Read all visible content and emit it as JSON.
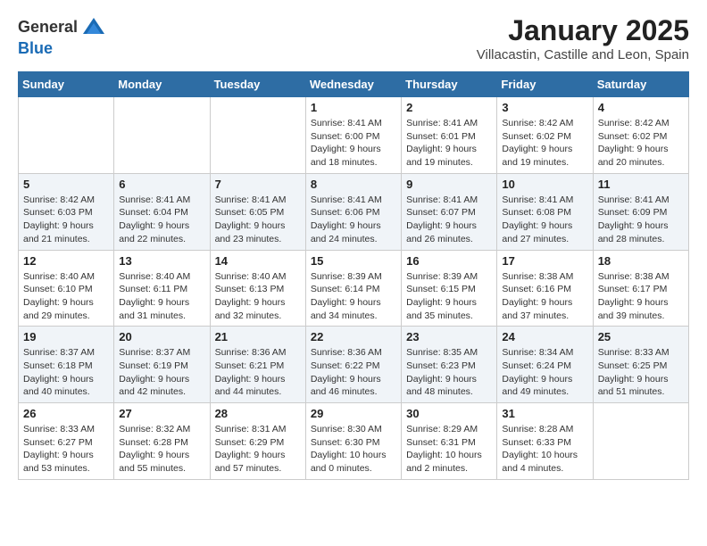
{
  "logo": {
    "general": "General",
    "blue": "Blue"
  },
  "header": {
    "month": "January 2025",
    "location": "Villacastin, Castille and Leon, Spain"
  },
  "weekdays": [
    "Sunday",
    "Monday",
    "Tuesday",
    "Wednesday",
    "Thursday",
    "Friday",
    "Saturday"
  ],
  "weeks": [
    [
      {
        "day": "",
        "text": ""
      },
      {
        "day": "",
        "text": ""
      },
      {
        "day": "",
        "text": ""
      },
      {
        "day": "1",
        "text": "Sunrise: 8:41 AM\nSunset: 6:00 PM\nDaylight: 9 hours and 18 minutes."
      },
      {
        "day": "2",
        "text": "Sunrise: 8:41 AM\nSunset: 6:01 PM\nDaylight: 9 hours and 19 minutes."
      },
      {
        "day": "3",
        "text": "Sunrise: 8:42 AM\nSunset: 6:02 PM\nDaylight: 9 hours and 19 minutes."
      },
      {
        "day": "4",
        "text": "Sunrise: 8:42 AM\nSunset: 6:02 PM\nDaylight: 9 hours and 20 minutes."
      }
    ],
    [
      {
        "day": "5",
        "text": "Sunrise: 8:42 AM\nSunset: 6:03 PM\nDaylight: 9 hours and 21 minutes."
      },
      {
        "day": "6",
        "text": "Sunrise: 8:41 AM\nSunset: 6:04 PM\nDaylight: 9 hours and 22 minutes."
      },
      {
        "day": "7",
        "text": "Sunrise: 8:41 AM\nSunset: 6:05 PM\nDaylight: 9 hours and 23 minutes."
      },
      {
        "day": "8",
        "text": "Sunrise: 8:41 AM\nSunset: 6:06 PM\nDaylight: 9 hours and 24 minutes."
      },
      {
        "day": "9",
        "text": "Sunrise: 8:41 AM\nSunset: 6:07 PM\nDaylight: 9 hours and 26 minutes."
      },
      {
        "day": "10",
        "text": "Sunrise: 8:41 AM\nSunset: 6:08 PM\nDaylight: 9 hours and 27 minutes."
      },
      {
        "day": "11",
        "text": "Sunrise: 8:41 AM\nSunset: 6:09 PM\nDaylight: 9 hours and 28 minutes."
      }
    ],
    [
      {
        "day": "12",
        "text": "Sunrise: 8:40 AM\nSunset: 6:10 PM\nDaylight: 9 hours and 29 minutes."
      },
      {
        "day": "13",
        "text": "Sunrise: 8:40 AM\nSunset: 6:11 PM\nDaylight: 9 hours and 31 minutes."
      },
      {
        "day": "14",
        "text": "Sunrise: 8:40 AM\nSunset: 6:13 PM\nDaylight: 9 hours and 32 minutes."
      },
      {
        "day": "15",
        "text": "Sunrise: 8:39 AM\nSunset: 6:14 PM\nDaylight: 9 hours and 34 minutes."
      },
      {
        "day": "16",
        "text": "Sunrise: 8:39 AM\nSunset: 6:15 PM\nDaylight: 9 hours and 35 minutes."
      },
      {
        "day": "17",
        "text": "Sunrise: 8:38 AM\nSunset: 6:16 PM\nDaylight: 9 hours and 37 minutes."
      },
      {
        "day": "18",
        "text": "Sunrise: 8:38 AM\nSunset: 6:17 PM\nDaylight: 9 hours and 39 minutes."
      }
    ],
    [
      {
        "day": "19",
        "text": "Sunrise: 8:37 AM\nSunset: 6:18 PM\nDaylight: 9 hours and 40 minutes."
      },
      {
        "day": "20",
        "text": "Sunrise: 8:37 AM\nSunset: 6:19 PM\nDaylight: 9 hours and 42 minutes."
      },
      {
        "day": "21",
        "text": "Sunrise: 8:36 AM\nSunset: 6:21 PM\nDaylight: 9 hours and 44 minutes."
      },
      {
        "day": "22",
        "text": "Sunrise: 8:36 AM\nSunset: 6:22 PM\nDaylight: 9 hours and 46 minutes."
      },
      {
        "day": "23",
        "text": "Sunrise: 8:35 AM\nSunset: 6:23 PM\nDaylight: 9 hours and 48 minutes."
      },
      {
        "day": "24",
        "text": "Sunrise: 8:34 AM\nSunset: 6:24 PM\nDaylight: 9 hours and 49 minutes."
      },
      {
        "day": "25",
        "text": "Sunrise: 8:33 AM\nSunset: 6:25 PM\nDaylight: 9 hours and 51 minutes."
      }
    ],
    [
      {
        "day": "26",
        "text": "Sunrise: 8:33 AM\nSunset: 6:27 PM\nDaylight: 9 hours and 53 minutes."
      },
      {
        "day": "27",
        "text": "Sunrise: 8:32 AM\nSunset: 6:28 PM\nDaylight: 9 hours and 55 minutes."
      },
      {
        "day": "28",
        "text": "Sunrise: 8:31 AM\nSunset: 6:29 PM\nDaylight: 9 hours and 57 minutes."
      },
      {
        "day": "29",
        "text": "Sunrise: 8:30 AM\nSunset: 6:30 PM\nDaylight: 10 hours and 0 minutes."
      },
      {
        "day": "30",
        "text": "Sunrise: 8:29 AM\nSunset: 6:31 PM\nDaylight: 10 hours and 2 minutes."
      },
      {
        "day": "31",
        "text": "Sunrise: 8:28 AM\nSunset: 6:33 PM\nDaylight: 10 hours and 4 minutes."
      },
      {
        "day": "",
        "text": ""
      }
    ]
  ]
}
